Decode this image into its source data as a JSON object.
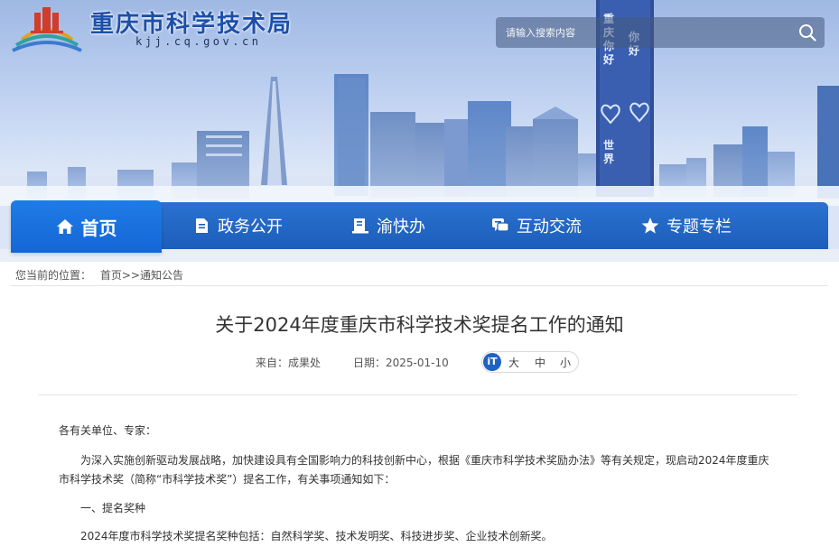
{
  "header": {
    "site_title": "重庆市科学技术局",
    "site_domain": "kjj.cq.gov.cn",
    "search_placeholder": "请输入搜索内容",
    "billboard_text": [
      "重庆",
      "你好",
      "世界",
      "你好"
    ]
  },
  "nav": {
    "items": [
      {
        "label": "首页",
        "icon": "home-icon",
        "active": true
      },
      {
        "label": "政务公开",
        "icon": "document-icon",
        "active": false
      },
      {
        "label": "渝快办",
        "icon": "service-icon",
        "active": false
      },
      {
        "label": "互动交流",
        "icon": "chat-icon",
        "active": false
      },
      {
        "label": "专题专栏",
        "icon": "star-icon",
        "active": false
      }
    ]
  },
  "breadcrumb": {
    "prefix": "您当前的位置：",
    "home": "首页",
    "separator": ">>",
    "current": "通知公告"
  },
  "article": {
    "title": "关于2024年度重庆市科学技术奖提名工作的通知",
    "source_label": "来自：成果处",
    "date_label": "日期：2025-01-10",
    "font_size": {
      "large": "大",
      "medium": "中",
      "small": "小"
    },
    "salutation": "各有关单位、专家：",
    "para1_line1": "为深入实施创新驱动发展战略，加快建设具有全国影响力的科技创新中心，根据《重庆市科学技术奖励办法》等有关规定，现启动2024年度重庆",
    "para1_line2": "市科学技术奖（简称“市科学技术奖”）提名工作，有关事项通知如下：",
    "section1": "一、提名奖种",
    "para2": "2024年度市科学技术奖提名奖种包括：自然科学奖、技术发明奖、科技进步奖、企业技术创新奖。"
  },
  "colors": {
    "brand_blue": "#1d4fa8",
    "nav_blue": "#1c5dbb",
    "nav_active": "#1e7ce6"
  }
}
